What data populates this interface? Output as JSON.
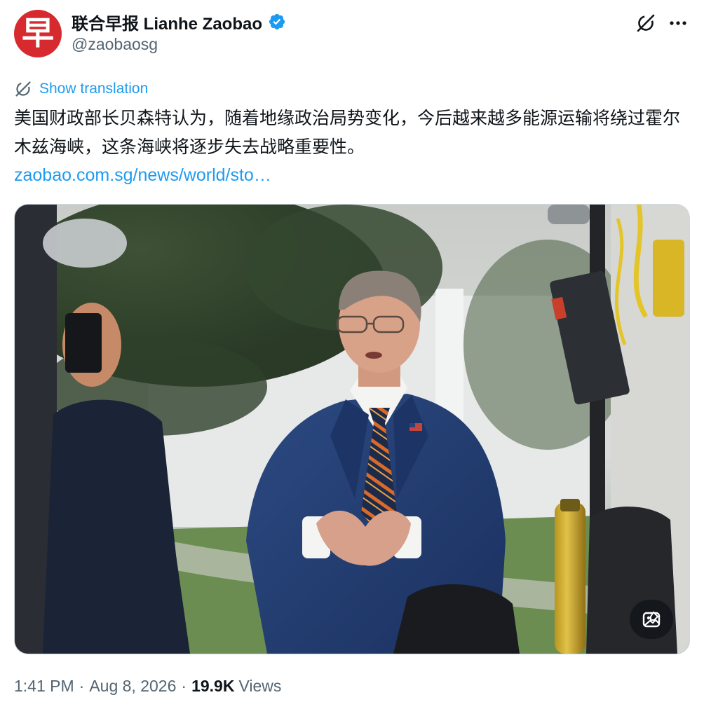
{
  "account": {
    "avatar_glyph": "早",
    "display_name": "联合早报 Lianhe Zaobao",
    "handle": "@zaobaosg",
    "verified": true,
    "brand_color": "#d62a2f",
    "verified_color": "#1d9bf0"
  },
  "header_actions": {
    "grok_icon": "grok-icon",
    "more_icon": "more-icon"
  },
  "translation": {
    "label": "Show translation",
    "icon": "translate-icon"
  },
  "tweet": {
    "text": "美国财政部长贝森特认为，随着地缘政治局势变化，今后越来越多能源运输将绕过霍尔木兹海峡，这条海峡将逐步失去战略重要性。",
    "link_text": "zaobao.com.sg/news/world/sto…",
    "link_color": "#1d9bf0"
  },
  "media": {
    "edit_image_icon": "edit-image-icon"
  },
  "meta": {
    "time": "1:41 PM",
    "date": "Aug 8, 2026",
    "views_count": "19.9K",
    "views_label": "Views"
  }
}
